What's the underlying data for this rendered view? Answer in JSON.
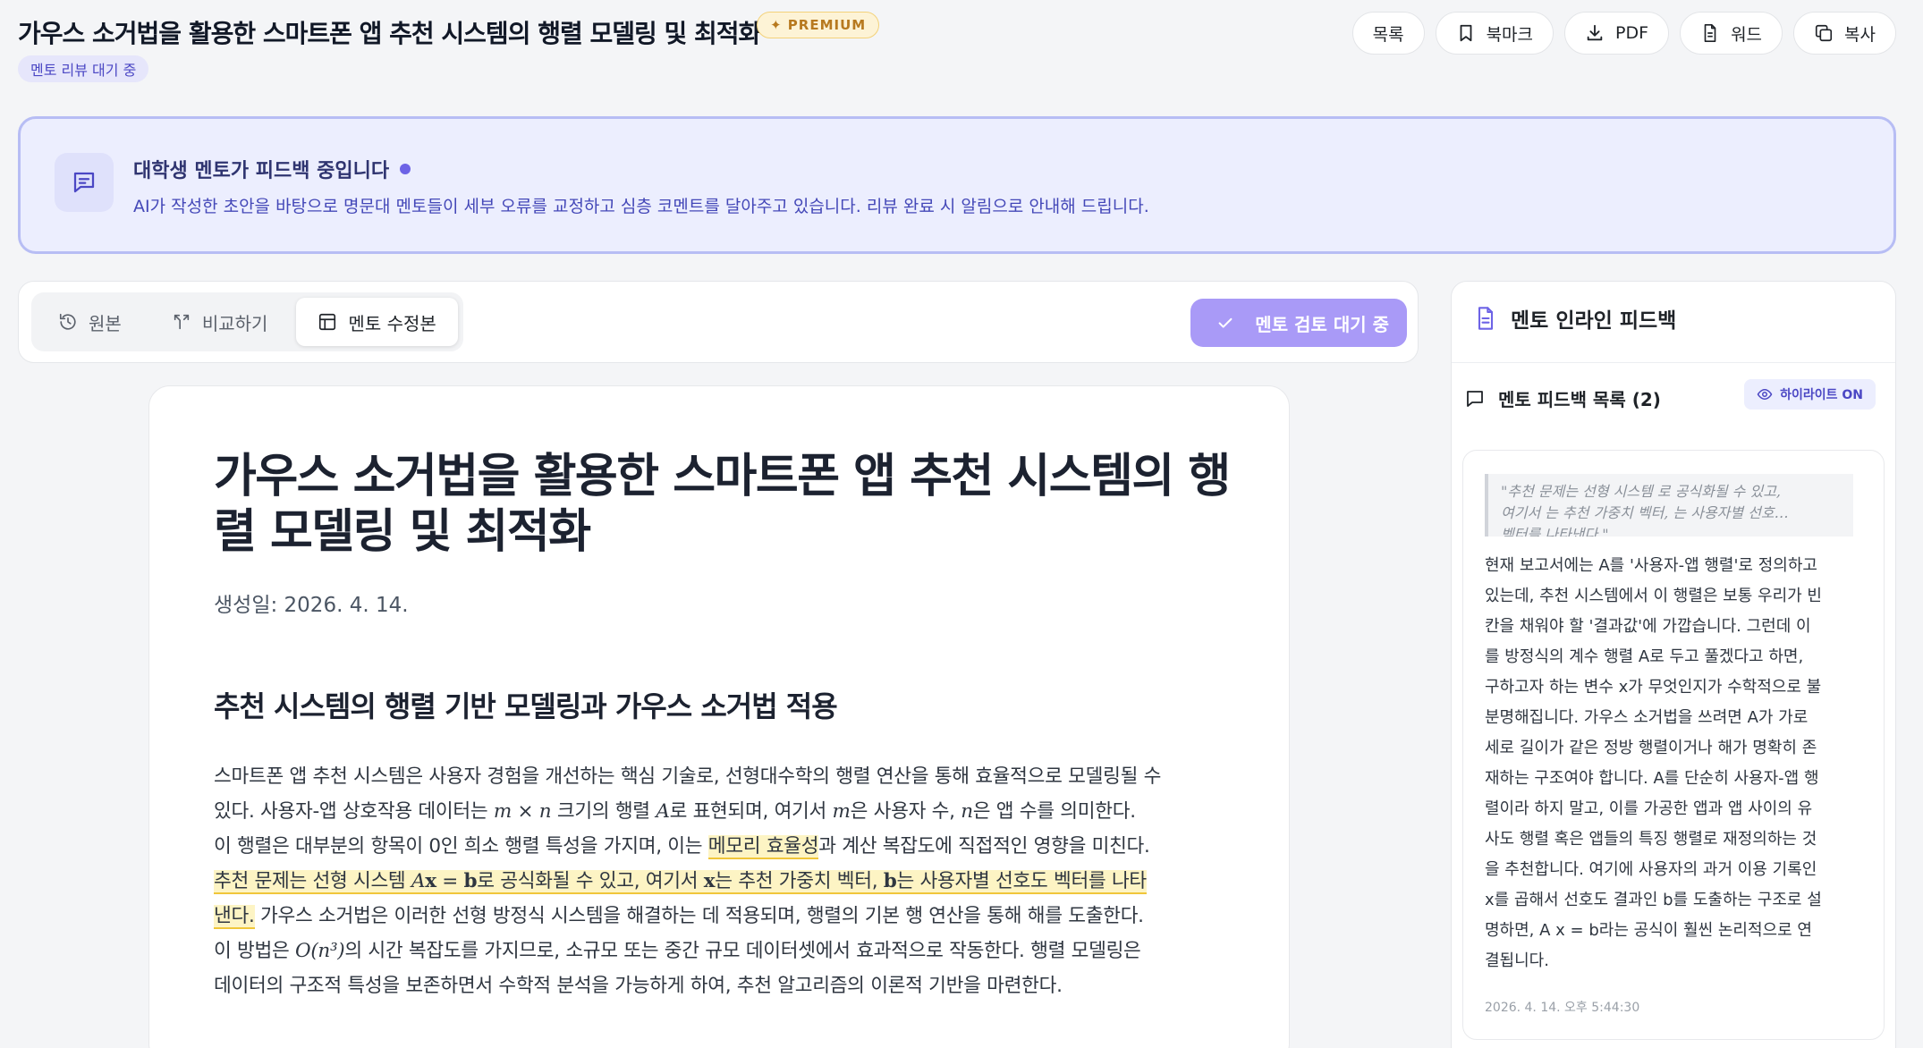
{
  "header": {
    "title": "가우스 소거법을 활용한 스마트폰 앱 추천 시스템의 행렬 모델링 및 최적화",
    "premium_badge": "✦ PREMIUM",
    "status": "멘토 리뷰 대기 중",
    "toolbar": {
      "list_label": "목록",
      "bookmark_label": "북마크",
      "pdf_label": "PDF",
      "word_label": "워드",
      "copy_label": "복사"
    }
  },
  "banner": {
    "title": "대학생 멘토가 피드백 중입니다",
    "description": "AI가 작성한 초안을 바탕으로 명문대 멘토들이 세부 오류를 교정하고 심층 코멘트를 달아주고 있습니다. 리뷰 완료 시 알림으로 안내해 드립니다."
  },
  "tabs": {
    "original": "원본",
    "compare": "비교하기",
    "mentor_revision": "멘토 수정본",
    "review_pending": "멘토 검토 대기 중"
  },
  "document": {
    "title": "가우스 소거법을 활용한 스마트폰 앱 추천 시스템의 행렬 모델링 및 최적화",
    "created": "생성일: 2026. 4. 14.",
    "section_heading": "추천 시스템의 행렬 기반 모델링과 가우스 소거법 적용",
    "paragraph": {
      "p1": "스마트폰 앱 추천 시스템은 사용자 경험을 개선하는 핵심 기술로, 선형대수학의 행렬 연산을 통해 효율적으로 모델링될 수",
      "p2a": "있다. 사용자-앱 상호작용 데이터는 ",
      "m_m": "m",
      "m_times": " × ",
      "m_n": "n",
      "p2b": " 크기의 행렬 ",
      "m_A": "A",
      "p2c": "로 표현되며, 여기서 ",
      "p2d": "은 사용자 수, ",
      "p2e": "은 앱 수를 의미한다.",
      "p3a": "이 행렬은 대부분의 항목이 0인 희소 행렬 특성을 가지며, 이는 ",
      "p3_hl": "메모리 효율성",
      "p3b": "과 계산 복잡도에 직접적인 영향을 미친다.",
      "p4a": "추천 문제는 선형 시스템 ",
      "m_Ax_eq": " = ",
      "m_x": "x",
      "m_b": "b",
      "p4b": "로 공식화될 수 있고, 여기서 ",
      "p4c": "는 추천 가중치 벡터, ",
      "p4d": "는 사용자별 선호도 벡터를 나타",
      "p5_hl": "낸다.",
      "p5b": " 가우스 소거법은 이러한 선형 방정식 시스템을 해결하는 데 적용되며, 행렬의 기본 행 연산을 통해 해를 도출한다.",
      "p6a": "이 방법은 ",
      "m_O": "O(n³)",
      "p6b": "의 시간 복잡도를 가지므로, 소규모 또는 중간 규모 데이터셋에서 효과적으로 작동한다. 행렬 모델링은",
      "p7": "데이터의 구조적 특성을 보존하면서 수학적 분석을 가능하게 하여, 추천 알고리즘의 이론적 기반을 마련한다."
    }
  },
  "sidebar": {
    "title": "멘토 인라인 피드백",
    "list_title": "멘토 피드백 목록 (2)",
    "highlight_toggle": "하이라이트 ON",
    "feedback": {
      "quote": {
        "l1": "\"추천 문제는 선형 시스템 로 공식화될 수 있고,",
        "l2": "여기서 는 추천 가중치 벡터, 는 사용자별 선호…",
        "l3": "벡터를 나타낸다.\""
      },
      "body": {
        "l1": "현재 보고서에는 A를 '사용자-앱 행렬'로 정의하고",
        "l2": "있는데, 추천 시스템에서 이 행렬은 보통 우리가 빈",
        "l3": "칸을 채워야 할 '결과값'에 가깝습니다. 그런데 이",
        "l4": "를 방정식의 계수 행렬 A로 두고 풀겠다고 하면,",
        "l5": "구하고자 하는 변수 x가 무엇인지가 수학적으로 불",
        "l6": "분명해집니다. 가우스 소거법을 쓰려면 A가 가로",
        "l7": "세로 길이가 같은 정방 행렬이거나 해가 명확히 존",
        "l8": "재하는 구조여야 합니다. A를 단순히 사용자-앱 행",
        "l9": "렬이라 하지 말고, 이를 가공한 앱과 앱 사이의 유",
        "l10": "사도 행렬 혹은 앱들의 특징 행렬로 재정의하는 것",
        "l11": "을 추천합니다. 여기에 사용자의 과거 이용 기록인",
        "l12": "x를 곱해서 선호도 결과인 b를 도출하는 구조로 설",
        "l13": "명하면, A x = b라는 공식이 훨씬 논리적으로 연",
        "l14": "결됩니다."
      },
      "timestamp": "2026. 4. 14. 오후 5:44:30"
    }
  },
  "colors": {
    "accent": "#6d63e6",
    "highlight": "#fdf4c4",
    "review_button": "#a99af7"
  }
}
